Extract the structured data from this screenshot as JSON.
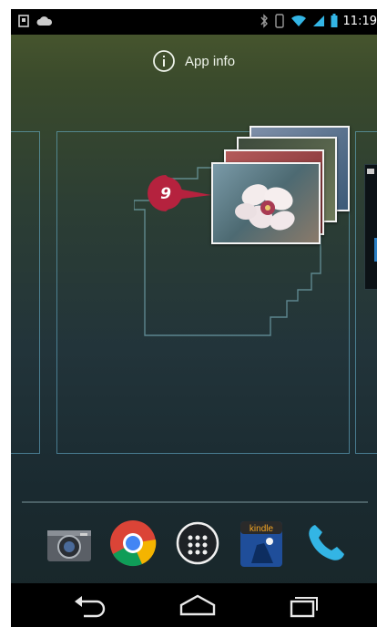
{
  "status_bar": {
    "time": "11:19"
  },
  "app_info": {
    "label": "App info"
  },
  "callout": {
    "number": "9"
  },
  "dock": {
    "items": [
      "camera-icon",
      "chrome-icon",
      "all-apps-icon",
      "kindle-icon",
      "phone-icon"
    ],
    "kindle_label": "kindle"
  },
  "nav_bar": {
    "buttons": [
      "back-icon",
      "home-icon",
      "recent-apps-icon"
    ]
  },
  "colors": {
    "callout": "#b5223e",
    "panel_outline": "#6ebedc",
    "status_icons": "#33b5e5"
  }
}
